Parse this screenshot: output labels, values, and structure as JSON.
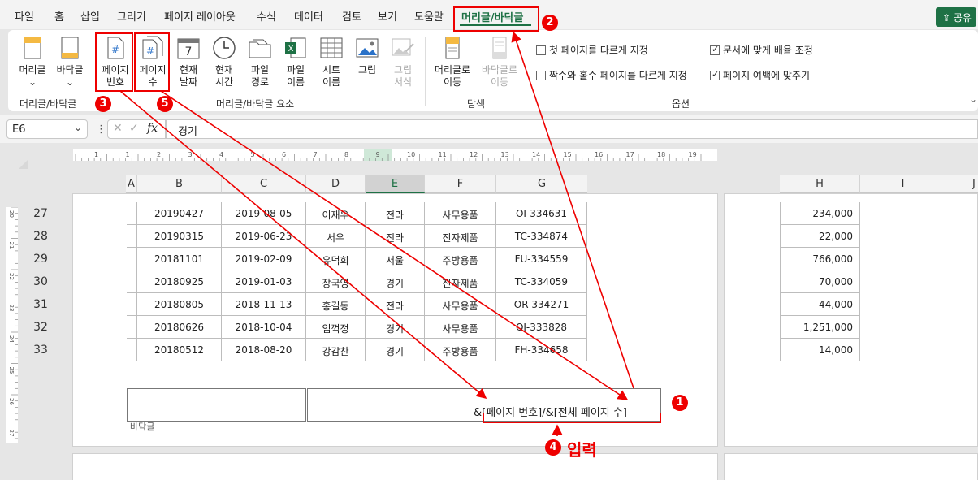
{
  "tabs": [
    "파일",
    "홈",
    "삽입",
    "그리기",
    "페이지 레이아웃",
    "수식",
    "데이터",
    "검토",
    "보기",
    "도움말",
    "머리글/바닥글"
  ],
  "share_label": "공유",
  "ribbon": {
    "header_footer_group": {
      "header": "머리글",
      "footer": "바닥글",
      "label": "머리글/바닥글"
    },
    "elements_group": {
      "page_number": [
        "페이지",
        "번호"
      ],
      "page_count": [
        "페이지",
        "수"
      ],
      "current_date": [
        "현재",
        "날짜"
      ],
      "current_time": [
        "현재",
        "시간"
      ],
      "file_path": [
        "파일",
        "경로"
      ],
      "file_name": [
        "파일",
        "이름"
      ],
      "sheet_name": [
        "시트",
        "이름"
      ],
      "picture": "그림",
      "format_picture": [
        "그림",
        "서식"
      ],
      "label": "머리글/바닥글 요소"
    },
    "nav_group": {
      "goto_header": [
        "머리글로",
        "이동"
      ],
      "goto_footer": [
        "바닥글로",
        "이동"
      ],
      "label": "탐색"
    },
    "options_group": {
      "diff_first": "첫 페이지를 다르게 지정",
      "diff_odd_even": "짝수와 홀수 페이지를 다르게 지정",
      "scale_with_doc": "문서에 맞게 배율 조정",
      "align_margins": "페이지 여백에 맞추기",
      "diff_first_checked": false,
      "diff_odd_even_checked": false,
      "scale_checked": true,
      "align_checked": true,
      "label": "옵션"
    }
  },
  "formula_bar": {
    "name_box": "E6",
    "fx": "fx",
    "content": "경기"
  },
  "ruler_marks": [
    "1",
    "1",
    "2",
    "3",
    "4",
    "5",
    "6",
    "7",
    "8",
    "9",
    "10",
    "11",
    "12",
    "13",
    "14",
    "15",
    "16",
    "17",
    "18",
    "19"
  ],
  "vruler_marks": [
    "20",
    "21",
    "22",
    "23",
    "24",
    "25",
    "26",
    "27"
  ],
  "columns_left": [
    "A",
    "B",
    "C",
    "D",
    "E",
    "F",
    "G"
  ],
  "columns_right": [
    "H",
    "I",
    "J"
  ],
  "rows": [
    {
      "num": "27",
      "b": "20190427",
      "c": "2019-08-05",
      "d": "이재우",
      "e": "전라",
      "f": "사무용품",
      "g": "OI-334631",
      "h": "234,000"
    },
    {
      "num": "28",
      "b": "20190315",
      "c": "2019-06-23",
      "d": "서우",
      "e": "전라",
      "f": "전자제품",
      "g": "TC-334874",
      "h": "22,000"
    },
    {
      "num": "29",
      "b": "20181101",
      "c": "2019-02-09",
      "d": "유덕희",
      "e": "서울",
      "f": "주방용품",
      "g": "FU-334559",
      "h": "766,000"
    },
    {
      "num": "30",
      "b": "20180925",
      "c": "2019-01-03",
      "d": "장국영",
      "e": "경기",
      "f": "전자제품",
      "g": "TC-334059",
      "h": "70,000"
    },
    {
      "num": "31",
      "b": "20180805",
      "c": "2018-11-13",
      "d": "홍길동",
      "e": "전라",
      "f": "사무용품",
      "g": "OR-334271",
      "h": "44,000"
    },
    {
      "num": "32",
      "b": "20180626",
      "c": "2018-10-04",
      "d": "임꺽정",
      "e": "경기",
      "f": "사무용품",
      "g": "OI-333828",
      "h": "1,251,000"
    },
    {
      "num": "33",
      "b": "20180512",
      "c": "2018-08-20",
      "d": "강감찬",
      "e": "경기",
      "f": "주방용품",
      "g": "FH-334658",
      "h": "14,000"
    }
  ],
  "footer": {
    "center_text": "&[페이지 번호]/&[전체 페이지 수]",
    "label": "바닥글"
  },
  "annotations": {
    "badges": [
      "1",
      "2",
      "3",
      "4",
      "5"
    ],
    "input_label": "입력",
    "color": "#e00000"
  }
}
